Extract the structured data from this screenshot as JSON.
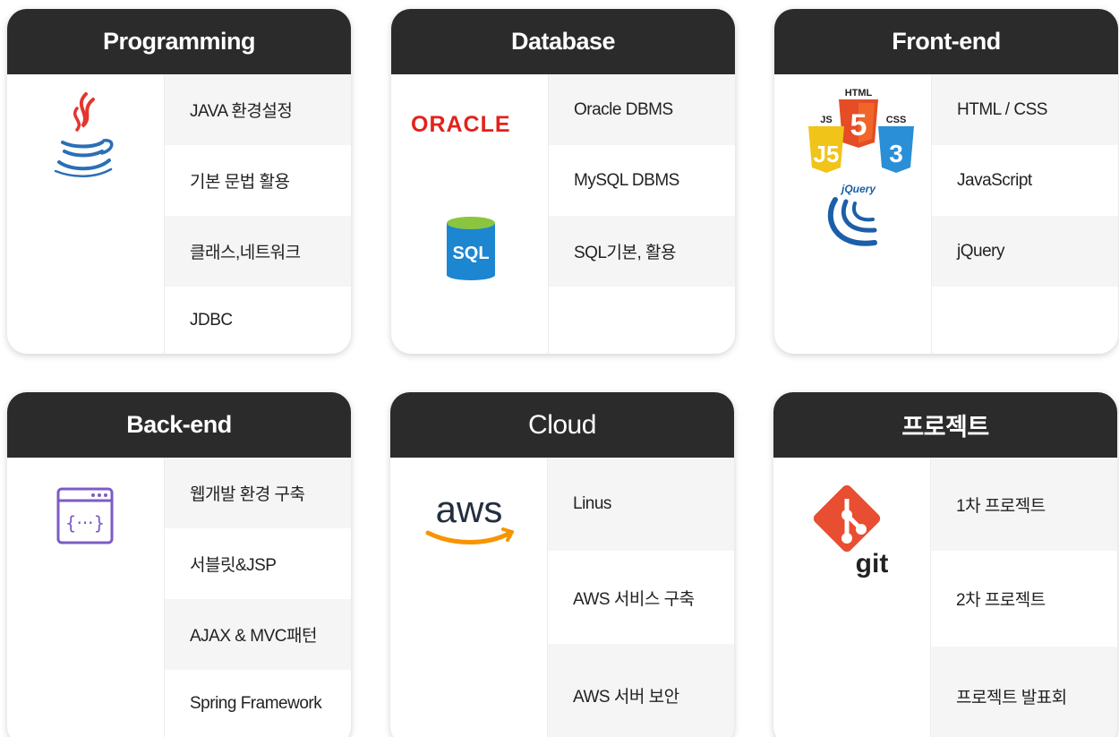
{
  "cards": [
    {
      "title": "Programming",
      "items": [
        "JAVA 환경설정",
        "기본 문법 활용",
        "클래스,네트워크",
        "JDBC"
      ]
    },
    {
      "title": "Database",
      "items": [
        "Oracle DBMS",
        "MySQL DBMS",
        "SQL기본, 활용",
        ""
      ],
      "logos": {
        "oracle": "ORACLE",
        "sql": "SQL"
      }
    },
    {
      "title": "Front-end",
      "items": [
        "HTML / CSS",
        "JavaScript",
        "jQuery",
        ""
      ],
      "logos": {
        "html": "HTML",
        "js": "JS",
        "css": "CSS",
        "jquery": "jQuery"
      }
    },
    {
      "title": "Back-end",
      "items": [
        "웹개발 환경 구축",
        "서블릿&JSP",
        "AJAX & MVC패턴",
        "Spring Framework"
      ]
    },
    {
      "title": "Cloud",
      "items": [
        "Linus",
        "AWS 서비스 구축",
        "AWS 서버 보안"
      ],
      "logos": {
        "aws": "aws"
      }
    },
    {
      "title": "프로젝트",
      "items": [
        "1차 프로젝트",
        "2차 프로젝트",
        "프로젝트 발표회"
      ],
      "logos": {
        "git": "git"
      }
    }
  ],
  "icons": [
    "java-icon",
    "oracle-logo",
    "sql-icon",
    "html5-icon",
    "js-icon",
    "css3-icon",
    "jquery-icon",
    "code-window-icon",
    "aws-logo",
    "git-icon"
  ],
  "colors": {
    "header": "#2b2b2b",
    "oracle": "#e2231a",
    "java_red": "#e5352e",
    "java_blue": "#2a6fb7",
    "html": "#e44d26",
    "js": "#f0c419",
    "css": "#2a8fd6",
    "jquery": "#1b5fa8",
    "aws_orange": "#f79400",
    "aws_text": "#232f3e",
    "git": "#e84e31",
    "code_icon": "#7c5cc4",
    "sql": "#1c86d1"
  }
}
